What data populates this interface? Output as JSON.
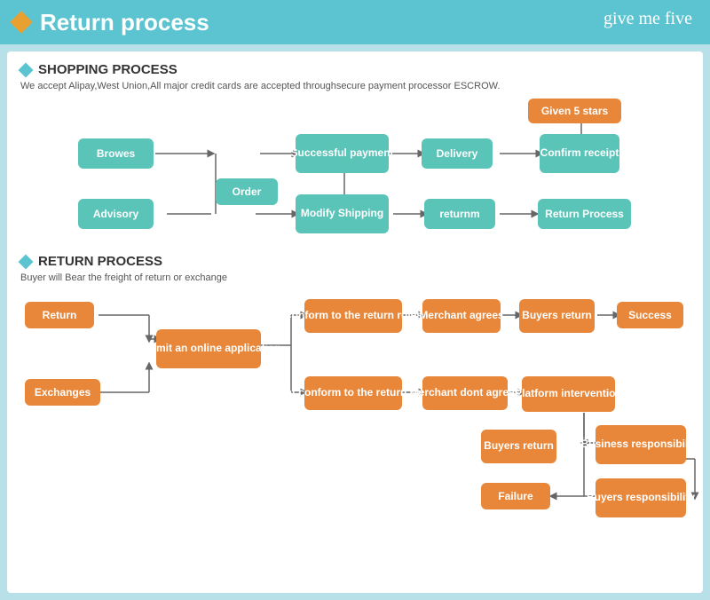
{
  "header": {
    "title": "Return process",
    "logo": "give me five"
  },
  "shopping": {
    "section_title": "SHOPPING PROCESS",
    "description": "We accept Alipay,West Union,All major credit cards are accepted throughsecure payment processor ESCROW.",
    "boxes": {
      "browes": "Browes",
      "order": "Order",
      "advisory": "Advisory",
      "modify_shipping": "Modify\nShipping",
      "successful_payment": "Successful\npayment",
      "delivery": "Delivery",
      "confirm_receipt": "Confirm\nreceipt",
      "given_5_stars": "Given 5 stars",
      "returnm": "returnm",
      "return_process": "Return Process"
    }
  },
  "return": {
    "section_title": "RETURN PROCESS",
    "description": "Buyer will Bear the freight of return or exchange",
    "boxes": {
      "return": "Return",
      "exchanges": "Exchanges",
      "submit_online": "Submit an online\napplication",
      "conform_rules": "Conform to the\nreturn rules",
      "dont_conform_rules": "Dont conform to the\nreturn rules",
      "merchant_agrees": "Merchant\nagrees",
      "merchant_dont_agrees": "Merchant\ndont agrees",
      "buyers_return1": "Buyers\nreturn",
      "buyers_return2": "Buyers\nreturn",
      "platform_intervention": "Platform\nintervention",
      "success": "Success",
      "business_responsibility": "Business\nresponsibility",
      "buyers_responsibility": "Buyers\nresponsibility",
      "failure": "Failure"
    }
  }
}
